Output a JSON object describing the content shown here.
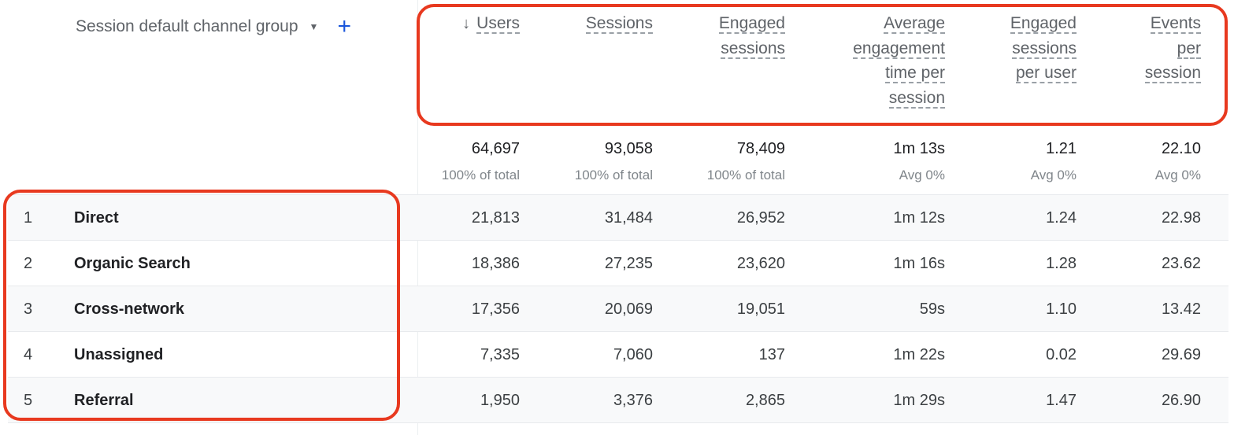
{
  "dimension": {
    "label": "Session default channel group",
    "dropdown_icon": "caret-down-icon",
    "add_icon": "plus-icon",
    "dropdown_glyph": "▼",
    "add_glyph": "+"
  },
  "sort_icon": {
    "name": "arrow-down-icon",
    "glyph": "↓"
  },
  "columns": [
    {
      "key": "users",
      "label_lines": [
        "Users"
      ],
      "sorted": true
    },
    {
      "key": "sessions",
      "label_lines": [
        "Sessions"
      ],
      "sorted": false
    },
    {
      "key": "engaged_sessions",
      "label_lines": [
        "Engaged",
        "sessions"
      ],
      "sorted": false
    },
    {
      "key": "avg_engagement_time",
      "label_lines": [
        "Average",
        "engagement",
        "time per",
        "session"
      ],
      "sorted": false
    },
    {
      "key": "engaged_sessions_per_user",
      "label_lines": [
        "Engaged",
        "sessions",
        "per user"
      ],
      "sorted": false
    },
    {
      "key": "events_per_session",
      "label_lines": [
        "Events",
        "per",
        "session"
      ],
      "sorted": false
    }
  ],
  "totals": [
    {
      "value": "64,697",
      "sub": "100% of total"
    },
    {
      "value": "93,058",
      "sub": "100% of total"
    },
    {
      "value": "78,409",
      "sub": "100% of total"
    },
    {
      "value": "1m 13s",
      "sub": "Avg 0%"
    },
    {
      "value": "1.21",
      "sub": "Avg 0%"
    },
    {
      "value": "22.10",
      "sub": "Avg 0%"
    }
  ],
  "rows": [
    {
      "rank": "1",
      "channel": "Direct",
      "values": [
        "21,813",
        "31,484",
        "26,952",
        "1m 12s",
        "1.24",
        "22.98"
      ]
    },
    {
      "rank": "2",
      "channel": "Organic Search",
      "values": [
        "18,386",
        "27,235",
        "23,620",
        "1m 16s",
        "1.28",
        "23.62"
      ]
    },
    {
      "rank": "3",
      "channel": "Cross-network",
      "values": [
        "17,356",
        "20,069",
        "19,051",
        "59s",
        "1.10",
        "13.42"
      ]
    },
    {
      "rank": "4",
      "channel": "Unassigned",
      "values": [
        "7,335",
        "7,060",
        "137",
        "1m 22s",
        "0.02",
        "29.69"
      ]
    },
    {
      "rank": "5",
      "channel": "Referral",
      "values": [
        "1,950",
        "3,376",
        "2,865",
        "1m 29s",
        "1.47",
        "26.90"
      ]
    }
  ],
  "annotation_color": "#e8391f"
}
